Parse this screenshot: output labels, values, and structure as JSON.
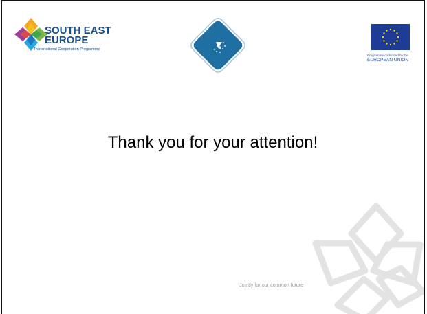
{
  "logos": {
    "see": {
      "line1": "SOUTH EAST",
      "line2": "EUROPE",
      "subtitle": "Transnational Cooperation Programme",
      "icon": "see-programme-logo"
    },
    "center": {
      "text": "danube",
      "icon": "project-emblem"
    },
    "eu": {
      "caption": "Programme co-funded by the",
      "name": "EUROPEAN UNION",
      "icon": "eu-flag-icon"
    }
  },
  "main": {
    "message": "Thank you for your attention!"
  },
  "footer": {
    "tagline": "Jointly for our common future"
  },
  "colors": {
    "see_blue": "#1a4f8f",
    "eu_blue": "#1e3c96",
    "eu_star": "#ffd400",
    "emblem_blue": "#1f6fa3",
    "motif_gray": "#e3e3e3",
    "tagline_gray": "#9a9a9a",
    "border": "#111111"
  }
}
